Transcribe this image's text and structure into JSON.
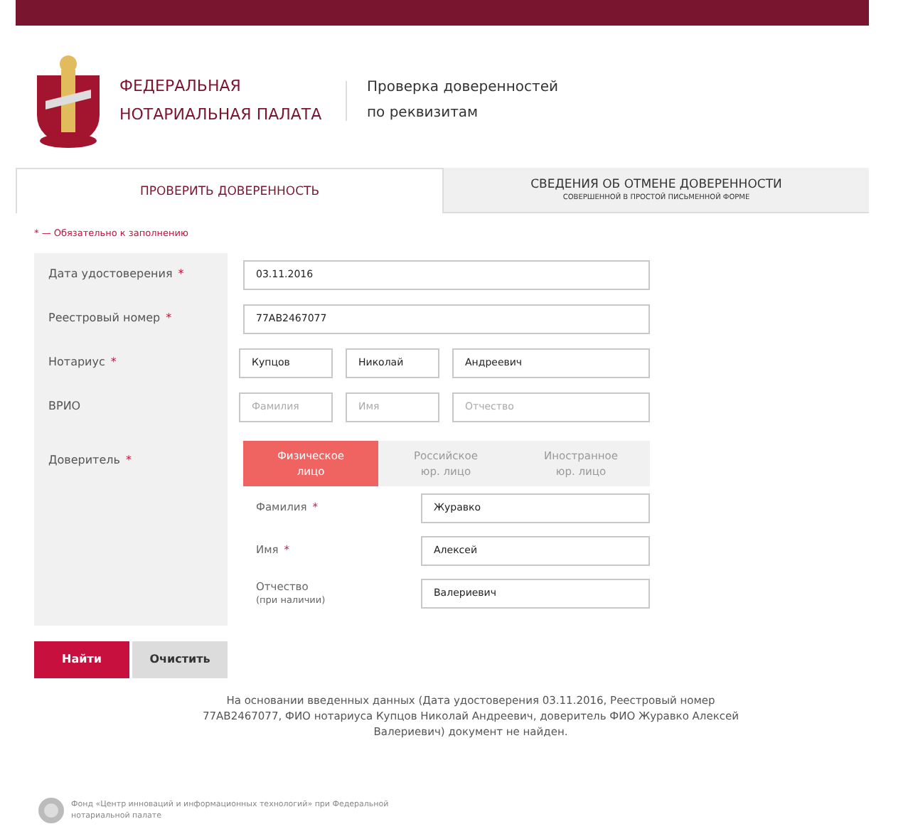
{
  "header": {
    "org_line1": "ФЕДЕРАЛЬНАЯ",
    "org_line2": "НОТАРИАЛЬНАЯ ПАЛАТА",
    "subtitle_line1": "Проверка доверенностей",
    "subtitle_line2": "по реквизитам"
  },
  "tabs": [
    {
      "label": "ПРОВЕРИТЬ ДОВЕРЕННОСТЬ",
      "selected": true
    },
    {
      "label": "СВЕДЕНИЯ ОБ ОТМЕНЕ ДОВЕРЕННОСТИ",
      "sublabel": "СОВЕРШЕННОЙ В ПРОСТОЙ ПИСЬМЕННОЙ ФОРМЕ",
      "selected": false
    }
  ],
  "required_note": {
    "mark": "*",
    "text": "— Обязательно к заполнению"
  },
  "fields": [
    {
      "label": "Дата удостоверения",
      "mark": "*",
      "inputs": [
        {
          "value": "03.11.2016"
        }
      ]
    },
    {
      "label": "Реестровый номер",
      "mark": "*",
      "inputs": [
        {
          "value": "77АВ2467077"
        }
      ]
    },
    {
      "label": "Нотариус",
      "mark": "*",
      "inputs": [
        {
          "value": "Купцов"
        },
        {
          "value": "Николай"
        },
        {
          "value": "Андреевич"
        }
      ]
    },
    {
      "label": "ВРИО",
      "inputs": [
        {
          "placeholder": "Фамилия"
        },
        {
          "placeholder": "Имя"
        },
        {
          "placeholder": "Отчество"
        }
      ]
    }
  ],
  "principal": {
    "label": "Доверитель",
    "mark": "*",
    "types": [
      {
        "line1": "Физическое",
        "line2": "лицо",
        "selected": true
      },
      {
        "line1": "Российское",
        "line2": "юр. лицо",
        "selected": false
      },
      {
        "line1": "Иностранное",
        "line2": "юр. лицо",
        "selected": false
      }
    ],
    "fields": [
      {
        "label": "Фамилия",
        "mark": "*",
        "value": "Журавко"
      },
      {
        "label": "Имя",
        "mark": "*",
        "value": "Алексей"
      },
      {
        "label": "Отчество",
        "note": "(при наличии)",
        "value": "Валериевич"
      }
    ]
  },
  "buttons": [
    {
      "label": "Найти",
      "kind": "primary"
    },
    {
      "label": "Очистить",
      "kind": "secondary"
    }
  ],
  "result": "На основании введенных данных (Дата удостоверения 03.11.2016, Реестровый номер 77АВ2467077, ФИО нотариуса Купцов Николай Андреевич, доверитель ФИО Журавко Алексей Валериевич) документ не найден.",
  "footer": "Фонд «Центр инноваций и информационных технологий» при Федеральной нотариальной палате"
}
